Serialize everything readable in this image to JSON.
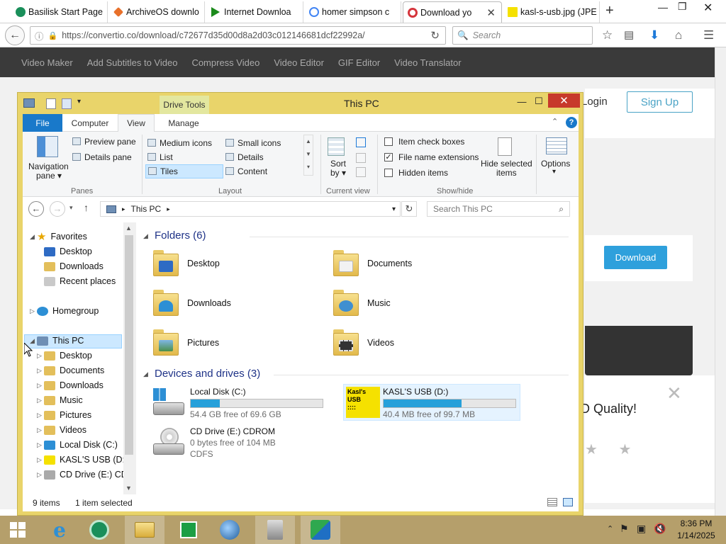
{
  "browser": {
    "tabs": [
      {
        "label": "Basilisk Start Page",
        "icon": "basilisk-icon"
      },
      {
        "label": "ArchiveOS downlo",
        "icon": "archiveos-icon"
      },
      {
        "label": "Internet Downloa",
        "icon": "play-icon"
      },
      {
        "label": "homer simpson c",
        "icon": "google-icon"
      },
      {
        "label": "Download yo",
        "icon": "convertio-icon",
        "active": true
      },
      {
        "label": "kasl-s-usb.jpg (JPE",
        "icon": "image-icon"
      }
    ],
    "new_tab": "+",
    "url": "https://convertio.co/download/c72677d35d00d8a2d03c012146681dcf22992a/",
    "search_placeholder": "Search"
  },
  "site": {
    "nav": [
      "Video Maker",
      "Add Subtitles to Video",
      "Compress Video",
      "Video Editor",
      "GIF Editor",
      "Video Translator"
    ],
    "login": "Login",
    "signup": "Sign Up",
    "download": "Download",
    "quality_text": "D Quality!",
    "stars": "★ ★"
  },
  "explorer": {
    "title": "This PC",
    "drive_tools": "Drive Tools",
    "ribbon_tabs": [
      "File",
      "Computer",
      "View",
      "Manage"
    ],
    "panes": {
      "navigation_pane": "Navigation",
      "navigation_pane2": "pane ▾",
      "preview_pane": "Preview pane",
      "details_pane": "Details pane",
      "group": "Panes"
    },
    "layout": {
      "medium_icons": "Medium icons",
      "small_icons": "Small icons",
      "list": "List",
      "details": "Details",
      "tiles": "Tiles",
      "content": "Content",
      "group": "Layout"
    },
    "current_view": {
      "sort_by": "Sort",
      "sort_by2": "by ▾",
      "group": "Current view"
    },
    "show_hide": {
      "item_check_boxes": "Item check boxes",
      "file_name_extensions": "File name extensions",
      "hidden_items": "Hidden items",
      "hide_selected": "Hide selected",
      "hide_selected2": "items",
      "group": "Show/hide"
    },
    "options": "Options",
    "address": "This PC",
    "search_placeholder": "Search This PC",
    "nav_tree": [
      {
        "label": "Favorites",
        "level": 0
      },
      {
        "label": "Desktop",
        "level": 1
      },
      {
        "label": "Downloads",
        "level": 1
      },
      {
        "label": "Recent places",
        "level": 1
      },
      {
        "label": "Homegroup",
        "level": 0
      },
      {
        "label": "This PC",
        "level": 0,
        "selected": true
      },
      {
        "label": "Desktop",
        "level": 1
      },
      {
        "label": "Documents",
        "level": 1
      },
      {
        "label": "Downloads",
        "level": 1
      },
      {
        "label": "Music",
        "level": 1
      },
      {
        "label": "Pictures",
        "level": 1
      },
      {
        "label": "Videos",
        "level": 1
      },
      {
        "label": "Local Disk (C:)",
        "level": 1
      },
      {
        "label": "KASL'S USB (D:)",
        "level": 1
      },
      {
        "label": "CD Drive (E:) CDF",
        "level": 1
      }
    ],
    "folders_header": "Folders (6)",
    "folders": [
      "Desktop",
      "Documents",
      "Downloads",
      "Music",
      "Pictures",
      "Videos"
    ],
    "drives_header": "Devices and drives (3)",
    "drives": [
      {
        "name": "Local Disk (C:)",
        "free": "54.4 GB free of 69.6 GB",
        "used_fraction": 0.22
      },
      {
        "name": "KASL'S USB (D:)",
        "free": "40.4 MB free of 99.7 MB",
        "used_fraction": 0.59
      },
      {
        "name": "CD Drive (E:) CDROM",
        "free": "0 bytes free of 104 MB",
        "fs": "CDFS"
      }
    ],
    "status_items": "9 items",
    "status_selected": "1 item selected"
  },
  "taskbar": {
    "time": "8:36 PM",
    "date": "1/14/2025",
    "apps": [
      "start-icon",
      "internet-explorer-icon",
      "basilisk-icon",
      "file-explorer-icon",
      "store-icon",
      "browser-icon",
      "usb-tool-icon",
      "internet-download-manager-icon"
    ]
  },
  "colors": {
    "accent": "#1979ca",
    "window_frame": "#e9d46a",
    "close": "#c7392b",
    "site_dark": "#3a3a3a",
    "site_button": "#2ea0dc"
  }
}
